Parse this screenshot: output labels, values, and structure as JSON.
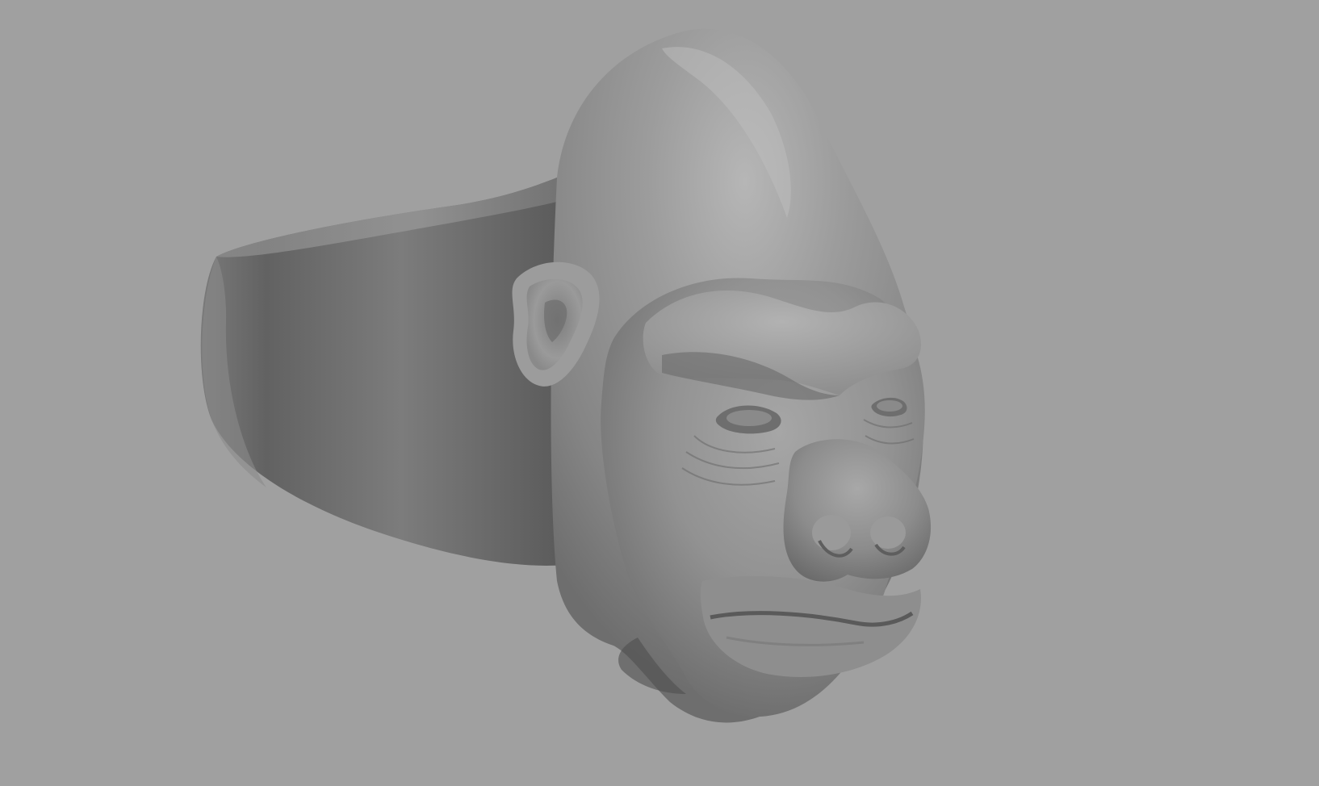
{
  "viewport": {
    "background_color": "#a0a0a0",
    "material_color": "#8c8c8c"
  },
  "model": {
    "subject": "gorilla-head-ring"
  }
}
